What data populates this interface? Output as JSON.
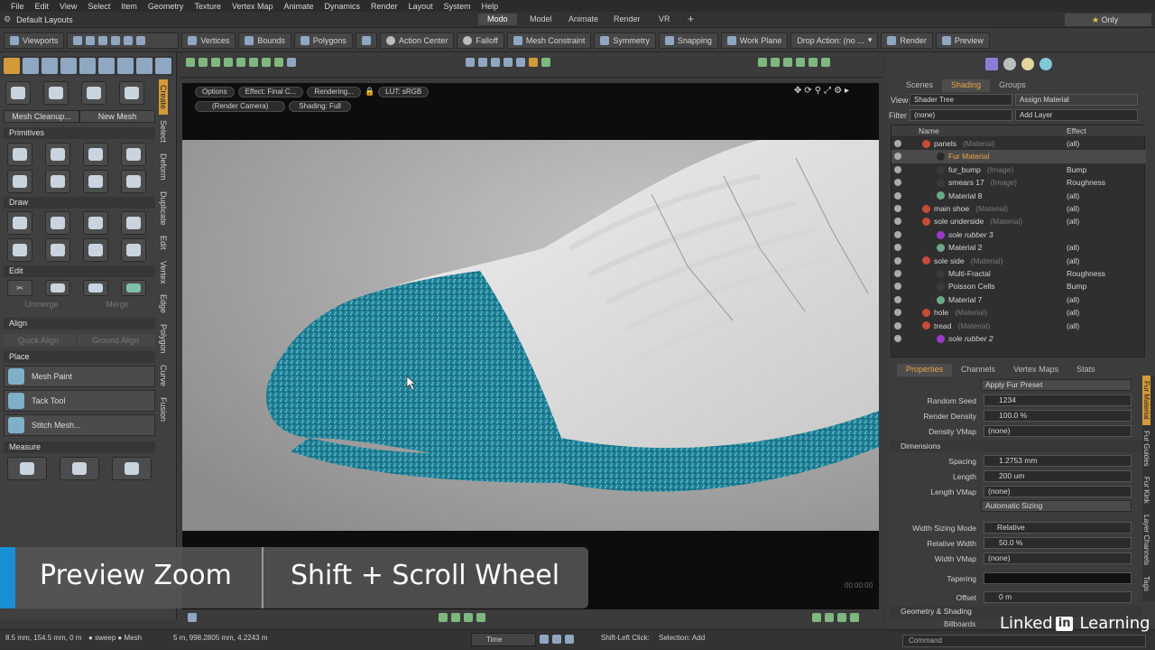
{
  "menu": [
    "File",
    "Edit",
    "View",
    "Select",
    "Item",
    "Geometry",
    "Texture",
    "Vertex Map",
    "Animate",
    "Dynamics",
    "Render",
    "Layout",
    "System",
    "Help"
  ],
  "layout_name": "Default Layouts",
  "mode_tabs": [
    "Modo",
    "Model",
    "Animate",
    "Render",
    "VR"
  ],
  "plus_tab": "+",
  "only_label": "Only",
  "toolbar": {
    "viewports": "Viewports",
    "vertices": "Vertices",
    "bounds": "Bounds",
    "polygons": "Polygons",
    "action_center": "Action Center",
    "falloff": "Falloff",
    "mesh_constraint": "Mesh Constraint",
    "symmetry": "Symmetry",
    "snapping": "Snapping",
    "work_plane": "Work Plane",
    "drop_action": "Drop Action: (no ...",
    "render": "Render",
    "preview": "Preview"
  },
  "left": {
    "mesh_cleanup": "Mesh Cleanup...",
    "new_mesh": "New Mesh",
    "primitives": "Primitives",
    "draw": "Draw",
    "edit": "Edit",
    "unmerge": "Unmerge",
    "merge": "Merge",
    "align": "Align",
    "quick_align": "Quick Align",
    "ground_align": "Ground Align",
    "place": "Place",
    "mesh_paint": "Mesh Paint",
    "tack_tool": "Tack Tool",
    "stitch_mesh": "Stitch Mesh...",
    "measure": "Measure",
    "vtabs": [
      "Create",
      "Select",
      "Deform",
      "Duplicate",
      "Edit",
      "Vertex",
      "Edge",
      "Polygon",
      "Curve",
      "Fusion"
    ]
  },
  "viewport": {
    "options": "Options",
    "effect": "Effect: Final C...",
    "rendering": "Rendering...",
    "lut": "LUT: sRGB",
    "camera": "(Render Camera)",
    "shading": "Shading: Full",
    "timecode": "00:00:00"
  },
  "right": {
    "tabs": [
      "Scenes",
      "Shading",
      "Groups"
    ],
    "view_label": "View",
    "view_value": "Shader Tree",
    "assign_material": "Assign Material",
    "filter_label": "Filter",
    "filter_value": "(none)",
    "add_layer": "Add Layer",
    "col_name": "Name",
    "col_effect": "Effect",
    "tree": [
      {
        "name": "panels",
        "type": "(Material)",
        "effect": "(all)",
        "ball": "#c84a3a",
        "indent": 1,
        "sel": false
      },
      {
        "name": "Fur Material",
        "type": "",
        "effect": "",
        "ball": "#2a2a2a",
        "indent": 2,
        "sel": true
      },
      {
        "name": "fur_bump",
        "type": "(Image)",
        "effect": "Bump",
        "ball": "#3a3a3a",
        "indent": 2,
        "sel": false
      },
      {
        "name": "smears 17",
        "type": "(Image)",
        "effect": "Roughness",
        "ball": "#3a3a3a",
        "indent": 2,
        "sel": false
      },
      {
        "name": "Material 8",
        "type": "",
        "effect": "(all)",
        "ball": "#6aa88a",
        "indent": 2,
        "sel": false
      },
      {
        "name": "main shoe",
        "type": "(Material)",
        "effect": "(all)",
        "ball": "#c84a3a",
        "indent": 1,
        "sel": false
      },
      {
        "name": "sole underside",
        "type": "(Material)",
        "effect": "(all)",
        "ball": "#c84a3a",
        "indent": 1,
        "sel": false
      },
      {
        "name": "sole rubber 3",
        "type": "",
        "effect": "",
        "ball": "#9a3ac8",
        "indent": 2,
        "sel": false
      },
      {
        "name": "Material 2",
        "type": "",
        "effect": "(all)",
        "ball": "#6aa88a",
        "indent": 2,
        "sel": false
      },
      {
        "name": "sole side",
        "type": "(Material)",
        "effect": "(all)",
        "ball": "#c84a3a",
        "indent": 1,
        "sel": false
      },
      {
        "name": "Multi-Fractal",
        "type": "",
        "effect": "Roughness",
        "ball": "#3a3a3a",
        "indent": 2,
        "sel": false
      },
      {
        "name": "Poisson Cells",
        "type": "",
        "effect": "Bump",
        "ball": "#3a3a3a",
        "indent": 2,
        "sel": false
      },
      {
        "name": "Material 7",
        "type": "",
        "effect": "(all)",
        "ball": "#6aa88a",
        "indent": 2,
        "sel": false
      },
      {
        "name": "hole",
        "type": "(Material)",
        "effect": "(all)",
        "ball": "#c84a3a",
        "indent": 1,
        "sel": false
      },
      {
        "name": "tread",
        "type": "(Material)",
        "effect": "(all)",
        "ball": "#c84a3a",
        "indent": 1,
        "sel": false
      },
      {
        "name": "sole rubber 2",
        "type": "",
        "effect": "",
        "ball": "#9a3ac8",
        "indent": 2,
        "sel": false
      }
    ],
    "prop_tabs": [
      "Properties",
      "Channels",
      "Vertex Maps",
      "Stats"
    ],
    "apply_fur_preset": "Apply Fur Preset",
    "props": {
      "random_seed_label": "Random Seed",
      "random_seed": "1234",
      "render_density_label": "Render Density",
      "render_density": "100.0 %",
      "density_vmap_label": "Density VMap",
      "density_vmap": "(none)",
      "dimensions": "Dimensions",
      "spacing_label": "Spacing",
      "spacing": "1.2753 mm",
      "length_label": "Length",
      "length": "200 um",
      "length_vmap_label": "Length VMap",
      "length_vmap": "(none)",
      "automatic_sizing": "Automatic Sizing",
      "width_sizing_mode_label": "Width Sizing Mode",
      "width_sizing_mode": "Relative",
      "relative_width_label": "Relative Width",
      "relative_width": "50.0 %",
      "width_vmap_label": "Width VMap",
      "width_vmap": "(none)",
      "tapering_label": "Tapering",
      "offset_label": "Offset",
      "offset": "0 m",
      "geometry_shading": "Geometry & Shading",
      "billboards": "Billboards"
    },
    "rvtabs": [
      "Fur Material",
      "Fur Guides",
      "Fur Kink",
      "Layer Channels",
      "Tags"
    ]
  },
  "banner": {
    "left": "Preview Zoom",
    "right": "Shift + Scroll Wheel"
  },
  "status": {
    "coords": "8.5 mm, 154.5 mm, 0 m",
    "sweep": "sweep",
    "mesh": "Mesh",
    "dims": "5 m, 998.2805 mm, 4.2243 m",
    "time": "Time",
    "hint": "Shift-Left Click:",
    "selection": "Selection: Add",
    "command": "Command"
  },
  "brand": {
    "linked": "Linked",
    "in": "in",
    "learning": "Learning"
  },
  "colors": {
    "accent": "#e9a244",
    "banner_bar": "#1a8fd6",
    "fur": "#2a8fa3"
  }
}
